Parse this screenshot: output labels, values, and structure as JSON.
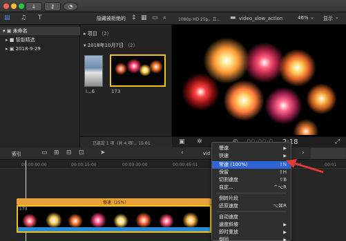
{
  "toolbar": {
    "filter_label": "隐藏被拒绝的",
    "viewer_format": "1080p HD 25p，立...",
    "viewer_clip_name": "video_slow_action",
    "zoom": "46%",
    "display_label": "显示"
  },
  "sidebar": {
    "library": "未命名",
    "items": [
      {
        "label": "智能精选"
      },
      {
        "label": "2018-9-29"
      }
    ]
  },
  "browser": {
    "group1": "项目",
    "group1_count": "（2）",
    "group2": "2018年10月7日",
    "group2_count": "（2）",
    "clip1_label": "l...6",
    "clip2_label": "173",
    "status": "已选定 1 项（共 4 项），15:01"
  },
  "viewer": {
    "timecode_dim": "00:00:0",
    "timecode": "2:18"
  },
  "timeline": {
    "index_label": "索引",
    "project_label": "vid",
    "ruler_ticks": [
      "00:00:00:00",
      "00:00:15:00",
      "00:00:30:00",
      "00:00:45:01"
    ],
    "ruler_tick_right": "1:04",
    "ruler_tick_far": "00:01",
    "speed_label": "慢速（25%）",
    "clip_number": "173"
  },
  "menu": {
    "items": [
      {
        "label": "慢速",
        "shortcut": "",
        "submenu": true
      },
      {
        "label": "快速",
        "shortcut": "",
        "submenu": true
      },
      {
        "label": "常速 (100%)",
        "shortcut": "⇧N",
        "submenu": false,
        "highlight": true
      },
      {
        "label": "保留",
        "shortcut": "⇧H",
        "submenu": false
      },
      {
        "label": "切割速度",
        "shortcut": "⇧B",
        "submenu": false
      },
      {
        "label": "自定...",
        "shortcut": "^⌥R",
        "submenu": false
      },
      {
        "label": "倒转片段",
        "shortcut": "",
        "submenu": false
      },
      {
        "label": "还原速度",
        "shortcut": "⌥⌘R",
        "submenu": false
      },
      {
        "label": "自动速度",
        "shortcut": "",
        "submenu": false
      },
      {
        "label": "速度斜坡",
        "shortcut": "",
        "submenu": true
      },
      {
        "label": "即时重放",
        "shortcut": "",
        "submenu": true
      },
      {
        "label": "倒回",
        "shortcut": "",
        "submenu": true
      }
    ]
  },
  "colors": {
    "accent": "#2f64d6",
    "selection_border": "#f0c419",
    "arrow": "#e53935",
    "speed_bar": "#e8a23a"
  }
}
